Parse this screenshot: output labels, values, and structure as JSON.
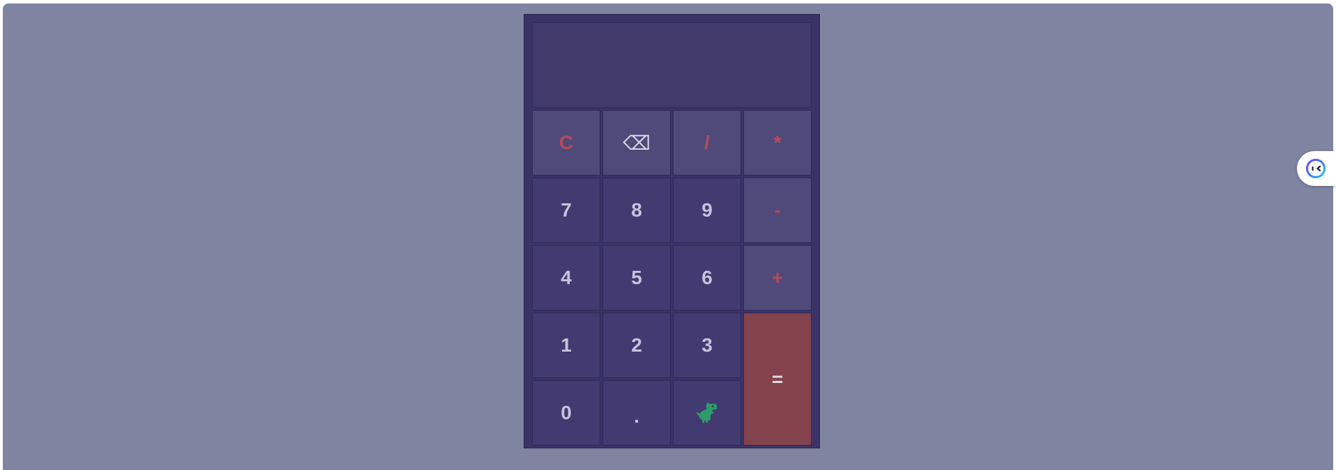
{
  "calculator": {
    "display_value": "",
    "keys": {
      "clear": "C",
      "backspace": "⌫",
      "divide": "/",
      "multiply": "*",
      "seven": "7",
      "eight": "8",
      "nine": "9",
      "subtract": "-",
      "four": "4",
      "five": "5",
      "six": "6",
      "add": "+",
      "one": "1",
      "two": "2",
      "three": "3",
      "equals": "=",
      "zero": "0",
      "decimal": ".",
      "dino_icon": "dinosaur-icon"
    }
  },
  "side_widget": {
    "icon": "assistant-face-icon"
  },
  "colors": {
    "page_background": "#8084a0",
    "calculator_background": "#3a3366",
    "display_background": "#413a6a",
    "number_key": "#423a70",
    "operator_key": "#4f4a7a",
    "operator_text": "#b74a5a",
    "equals_key": "#84424d"
  }
}
